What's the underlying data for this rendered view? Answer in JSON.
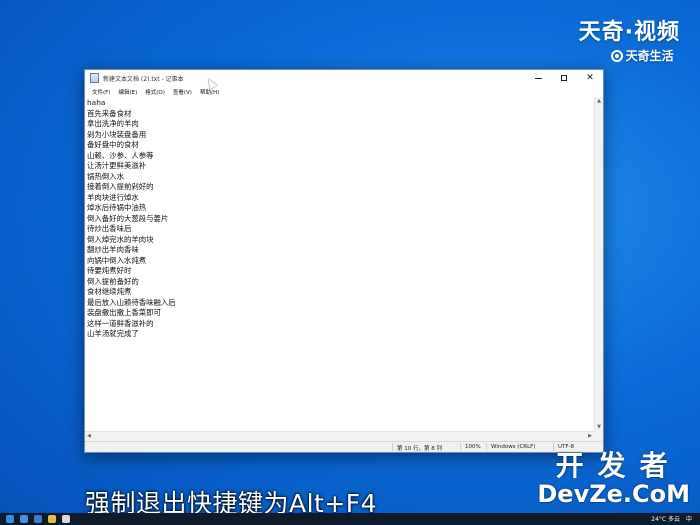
{
  "watermark_top": {
    "line1": "天奇·视频",
    "line2": "天奇生活"
  },
  "window": {
    "title": "新建文本文档 (2).txt - 记事本",
    "controls": {
      "minimize": "—",
      "maximize": "□",
      "close": "✕"
    },
    "menu": [
      "文件(F)",
      "编辑(E)",
      "格式(O)",
      "查看(V)",
      "帮助(H)"
    ],
    "lines": [
      "haha",
      "首先来备食材",
      "拿出洗净的羊肉",
      "剁为小块装盘备用",
      "备好盘中的食材",
      "山赖、沙参、人参等",
      "让汤汁更鲜美滋补",
      "锅热倒入水",
      "接着倒入提前剁好的",
      "羊肉块进行焯水",
      "焯水后待锅中油热",
      "倒入备好的大葱段与姜片",
      "待炒出香味后",
      "倒入焯完水的羊肉块",
      "翻炒出羊肉香味",
      "向锅中倒入水炖煮",
      "待要炖煮好时",
      "倒入提前备好的",
      "食材继续炖煮",
      "最后放入山赖待香味融入后",
      "装盘撒出撒上香菜即可",
      "这样一道鲜香滋补的",
      "山羊汤就完成了"
    ],
    "status": {
      "position": "第 10 行，第 8 列",
      "zoom": "100%",
      "line_ending": "Windows (CRLF)",
      "encoding": "UTF-8"
    }
  },
  "caption": "强制退出快捷键为Alt+F4",
  "watermark_bottom": {
    "line1": "开发者",
    "line2": "DevZe.CoM"
  },
  "taskbar": {
    "weather": "24°C 多云",
    "ime": "中"
  }
}
